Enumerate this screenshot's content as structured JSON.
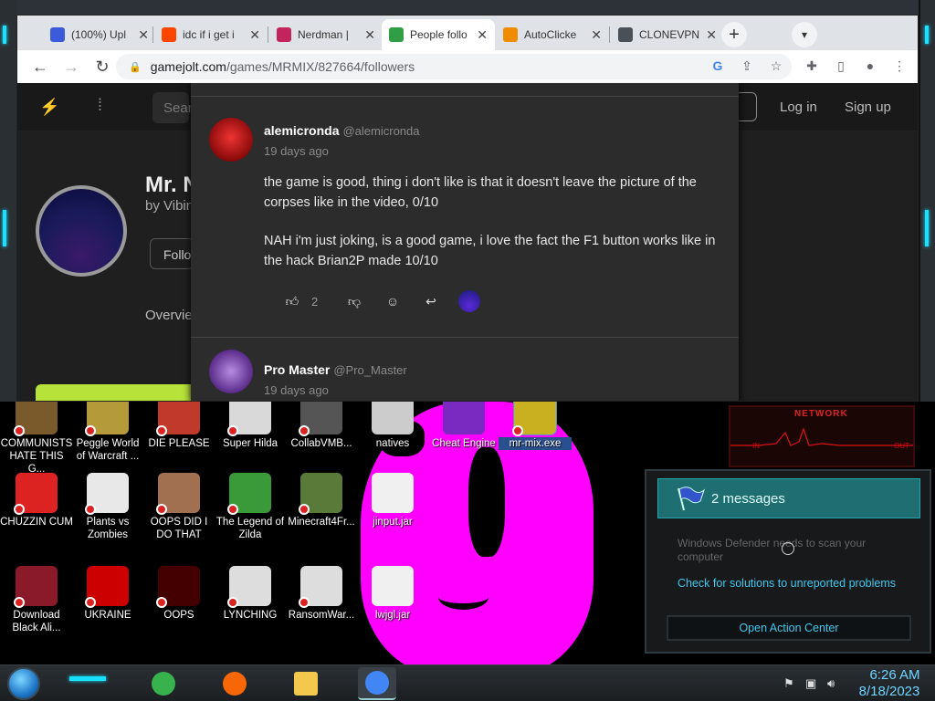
{
  "browser": {
    "tabs": [
      {
        "title": "(100%) Upl",
        "favicon": "vl-icon",
        "color": "#3b5bdb"
      },
      {
        "title": "idc if i get i",
        "favicon": "reddit-icon",
        "color": "#ff4500"
      },
      {
        "title": "Nerdman |",
        "favicon": "nerdman-icon",
        "color": "#c2255c"
      },
      {
        "title": "People follo",
        "favicon": "gamejolt-icon",
        "color": "#2f9e44",
        "active": true
      },
      {
        "title": "AutoClicke",
        "favicon": "autoclicker-icon",
        "color": "#f08c00"
      },
      {
        "title": "CLONEVPN",
        "favicon": "globe-icon",
        "color": "#495057"
      }
    ],
    "url_host": "gamejolt.com",
    "url_path": "/games/MRMIX/827664/followers"
  },
  "page": {
    "nav": {
      "search_placeholder": "Sear",
      "login": "Log in",
      "signup": "Sign up"
    },
    "profile": {
      "name": "Mr. N",
      "by": "by Vibin",
      "follow": "Follo",
      "overview": "Overvie"
    }
  },
  "comments": [
    {
      "user": "alemicronda",
      "handle": "@alemicronda",
      "time": "19 days ago",
      "paragraphs": [
        "the game is good, thing i don't like is that it doesn't leave the picture of the corpses like in the video, 0/10",
        "NAH i'm just joking, is a good game, i love the fact the F1 button works like in the hack Brian2P made 10/10"
      ],
      "likes": "2"
    },
    {
      "user": "Pro Master",
      "handle": "@Pro_Master",
      "time": "19 days ago"
    }
  ],
  "desktop_icons": [
    {
      "label": "COMMUNISTS HATE THIS G...",
      "icon": "money-icon"
    },
    {
      "label": "Peggle World of Warcraft ...",
      "icon": "peggle-icon"
    },
    {
      "label": "DIE PLEASE",
      "icon": "adobe-icon"
    },
    {
      "label": "Super Hilda",
      "icon": "pixel-art-icon"
    },
    {
      "label": "CollabVMB...",
      "icon": "collabvm-icon"
    },
    {
      "label": "natives",
      "icon": "folder-icon"
    },
    {
      "label": "Cheat Engine",
      "icon": "cheat-engine-icon"
    },
    {
      "label": "mr-mix.exe",
      "icon": "mrmix-icon"
    },
    {
      "label": "CHUZZIN CUM",
      "icon": "chuzzle-icon"
    },
    {
      "label": "Plants vs Zombies",
      "icon": "pvz-icon"
    },
    {
      "label": "OOPS DID I DO THAT",
      "icon": "portrait-icon"
    },
    {
      "label": "The Legend of Zilda",
      "icon": "zelda-icon"
    },
    {
      "label": "Minecraft4Fr...",
      "icon": "minecraft-icon"
    },
    {
      "label": "jinput.jar",
      "icon": "java-icon"
    },
    {
      "label": "Download Black Ali...",
      "icon": "virus-icon"
    },
    {
      "label": "UKRAINE",
      "icon": "radiation-icon"
    },
    {
      "label": "OOPS",
      "icon": "oops-icon"
    },
    {
      "label": "LYNCHING",
      "icon": "lynching-icon"
    },
    {
      "label": "RansomWar...",
      "icon": "skull-icon"
    },
    {
      "label": "lwjgl.jar",
      "icon": "java-icon"
    }
  ],
  "network_widget": {
    "title": "NETWORK",
    "left": "IN",
    "right": "OUT"
  },
  "action_center": {
    "title": "2 messages",
    "defender": "Windows Defender needs to scan your computer",
    "link": "Check for solutions to unreported problems",
    "open": "Open Action Center"
  },
  "taskbar": {
    "apps": [
      {
        "name": "notes-app-icon",
        "color": "#37b24d"
      },
      {
        "name": "firefox-icon",
        "color": "#f76707"
      },
      {
        "name": "file-explorer-icon",
        "color": "#f2c94c"
      },
      {
        "name": "chrome-icon",
        "color": "#4285f4",
        "active": true
      }
    ],
    "time": "6:26 AM",
    "date": "8/18/2023"
  },
  "colors": {
    "accent": "#19e1ff",
    "pink": "#ff00ff",
    "link": "#3fc8ee"
  }
}
